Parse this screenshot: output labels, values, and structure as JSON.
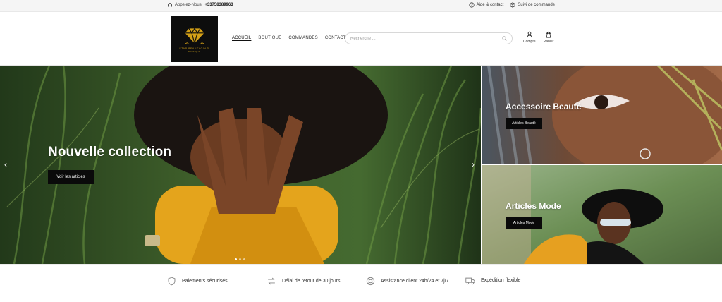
{
  "topbar": {
    "call_label": "Appelez-Nous:",
    "phone": "+33758389963",
    "help_label": "Aide & contact",
    "track_label": "Suivi de commande"
  },
  "header": {
    "logo": {
      "brand": "STAR BEAUTYGOLD",
      "sub": "BOUTIQUE"
    },
    "nav": [
      {
        "label": "ACCUEIL",
        "active": true
      },
      {
        "label": "BOUTIQUE",
        "active": false
      },
      {
        "label": "COMMANDES",
        "active": false
      },
      {
        "label": "CONTACT",
        "active": false
      }
    ],
    "search": {
      "placeholder": "Recherche ...",
      "value": ""
    },
    "account_label": "Compte",
    "cart_label": "Panier"
  },
  "hero": {
    "title": "Nouvelle collection",
    "cta_label": "Voir les articles",
    "slide_count": 3,
    "active_slide": 0
  },
  "banners": [
    {
      "title": "Accessoire Beauté",
      "cta_label": "Articles Beauté"
    },
    {
      "title": "Articles Mode",
      "cta_label": "Articles Mode"
    }
  ],
  "features": [
    {
      "icon": "shield-icon",
      "label": "Paiements sécurisés"
    },
    {
      "icon": "exchange-arrows-icon",
      "label": "Délai de retour de 30 jours"
    },
    {
      "icon": "lifebuoy-icon",
      "label": "Assistance client 24h/24 et 7j/7"
    },
    {
      "icon": "truck-icon",
      "label": "Expédition flexible"
    }
  ],
  "colors": {
    "accent_gold": "#d4a017",
    "dark_button": "#0a0a0a",
    "logo_background": "#0d0d0d"
  }
}
